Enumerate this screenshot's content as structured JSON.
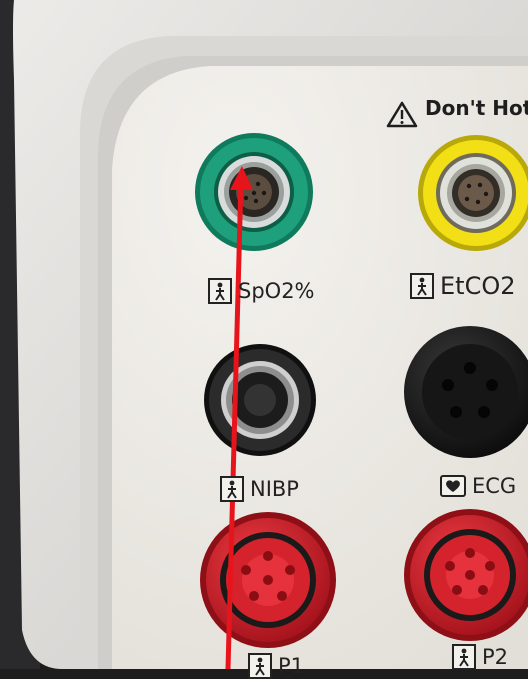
{
  "warning": {
    "text": "Don't Hot"
  },
  "connectors": {
    "spo2": {
      "label": "SpO2%",
      "color": "#1fa07c",
      "icon": "patient-icon"
    },
    "etco2": {
      "label": "EtCO2",
      "color": "#f2df16",
      "icon": "patient-icon"
    },
    "nibp": {
      "label": "NIBP",
      "color": "#1a1a1a",
      "icon": "patient-icon"
    },
    "ecg": {
      "label": "ECG",
      "color": "#111111",
      "icon": "heart-icon"
    },
    "p1": {
      "label": "P1",
      "color": "#d1202a",
      "icon": "patient-icon"
    },
    "p2": {
      "label": "P2",
      "color": "#d1202a",
      "icon": "patient-icon"
    }
  },
  "annotation": {
    "arrow_color": "#e8141c"
  }
}
